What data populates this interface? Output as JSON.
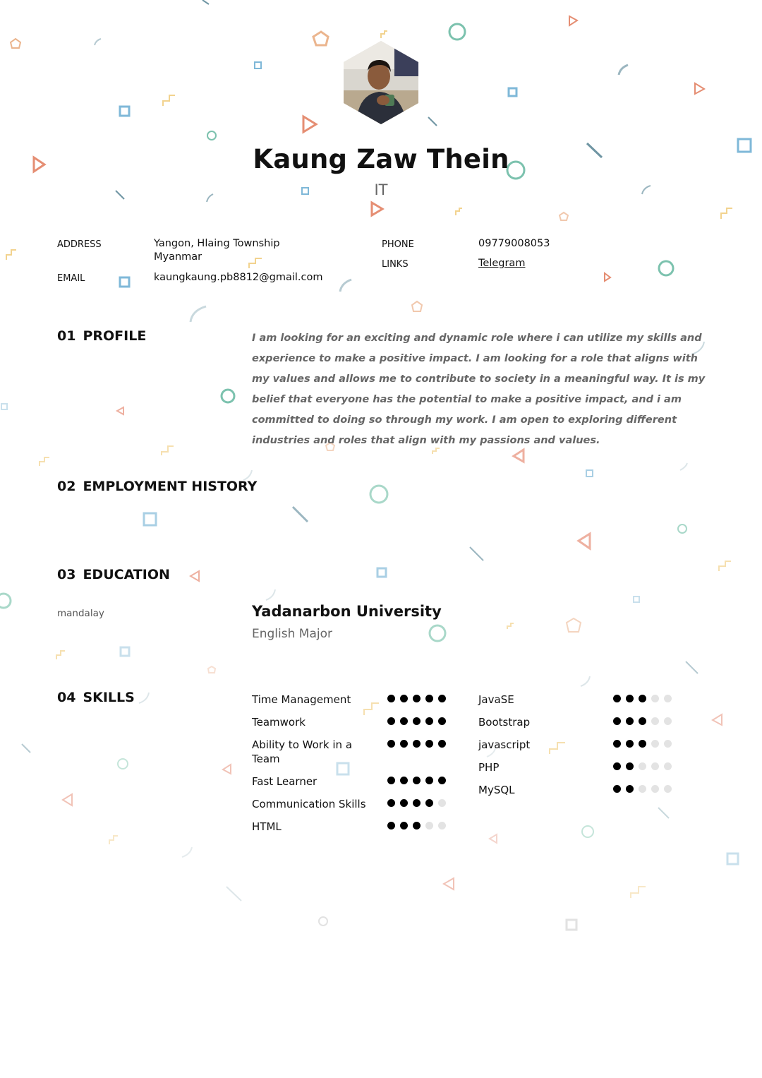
{
  "header": {
    "name": "Kaung Zaw Thein",
    "title": "IT"
  },
  "contact": {
    "address_label": "ADDRESS",
    "address_line1": "Yangon, Hlaing Township",
    "address_line2": "Myanmar",
    "email_label": "EMAIL",
    "email": "kaungkaung.pb8812@gmail.com",
    "phone_label": "PHONE",
    "phone": "09779008053",
    "links_label": "LINKS",
    "link_telegram": "Telegram"
  },
  "sections": {
    "profile": {
      "num": "01",
      "title": "PROFILE",
      "text": "I am looking for an exciting and dynamic role where i can utilize my skills and experience to make a positive impact. I am looking for a role that aligns with my values and allows me to contribute to society in a meaningful way. It is my belief that everyone has the potential to make a positive impact, and i am committed to doing so through my work. I am open to exploring different industries and roles that align with my passions and values."
    },
    "employment": {
      "num": "02",
      "title": "EMPLOYMENT HISTORY"
    },
    "education": {
      "num": "03",
      "title": "EDUCATION",
      "city": "mandalay",
      "school": "Yadanarbon University",
      "degree": "English Major"
    },
    "skills": {
      "num": "04",
      "title": "SKILLS"
    }
  },
  "skills_left": [
    {
      "name": "Time Management",
      "level": 5
    },
    {
      "name": "Teamwork",
      "level": 5
    },
    {
      "name": "Ability to Work in a Team",
      "level": 5
    },
    {
      "name": "Fast Learner",
      "level": 5
    },
    {
      "name": "Communication Skills",
      "level": 4
    },
    {
      "name": "HTML",
      "level": 3
    }
  ],
  "skills_right": [
    {
      "name": "JavaSE",
      "level": 3
    },
    {
      "name": "Bootstrap",
      "level": 3
    },
    {
      "name": "javascript",
      "level": 3
    },
    {
      "name": "PHP",
      "level": 2
    },
    {
      "name": "MySQL",
      "level": 2
    }
  ],
  "skill_max": 5,
  "colors": {
    "teal": "#7cc2ae",
    "blue": "#7fb8d8",
    "orange": "#e58e73",
    "yellow": "#f2d38f",
    "slate": "#6f95a3"
  }
}
